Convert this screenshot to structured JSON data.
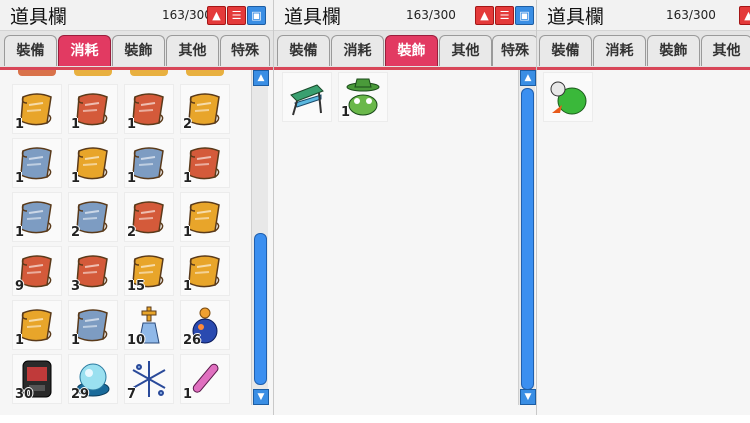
{
  "colors": {
    "scroll_gold": "#e8a52a",
    "scroll_red": "#d45a3a",
    "scroll_blue": "#7d9cc2",
    "active_tab": "#e23a62"
  },
  "panels": [
    {
      "title": "道具欄",
      "count": "163/300",
      "tabs": [
        "裝備",
        "消耗",
        "裝飾",
        "其他",
        "特殊"
      ],
      "active_tab": "消耗",
      "items": [
        {
          "icon": "gold-scroll-icon",
          "qty": "1"
        },
        {
          "icon": "red-scroll-icon",
          "qty": "1"
        },
        {
          "icon": "red-scroll-icon",
          "qty": "1"
        },
        {
          "icon": "gold-scroll-icon",
          "qty": "2"
        },
        {
          "icon": "blue-scroll-icon",
          "qty": "1"
        },
        {
          "icon": "gold-scroll-icon",
          "qty": "1"
        },
        {
          "icon": "blue-scroll-icon",
          "qty": "1"
        },
        {
          "icon": "red-scroll-icon",
          "qty": "1"
        },
        {
          "icon": "blue-scroll-icon",
          "qty": "1"
        },
        {
          "icon": "blue-scroll-icon",
          "qty": "2"
        },
        {
          "icon": "red-scroll-icon",
          "qty": "2"
        },
        {
          "icon": "gold-scroll-icon",
          "qty": "1"
        },
        {
          "icon": "red-scroll-icon",
          "qty": "9"
        },
        {
          "icon": "red-scroll-icon",
          "qty": "3"
        },
        {
          "icon": "gold-scroll-icon",
          "qty": "15"
        },
        {
          "icon": "gold-scroll-icon",
          "qty": "1"
        },
        {
          "icon": "gold-scroll-icon",
          "qty": "1"
        },
        {
          "icon": "blue-scroll-icon",
          "qty": "1"
        },
        {
          "icon": "cross-potion-icon",
          "qty": "10"
        },
        {
          "icon": "blue-potion-icon",
          "qty": "26"
        },
        {
          "icon": "device-icon",
          "qty": "30"
        },
        {
          "icon": "crystal-orb-icon",
          "qty": "29"
        },
        {
          "icon": "snowflake-icon",
          "qty": "7"
        },
        {
          "icon": "pink-vial-icon",
          "qty": "1"
        }
      ]
    },
    {
      "title": "道具欄",
      "count": "163/300",
      "tabs": [
        "裝備",
        "消耗",
        "裝飾",
        "其他",
        "特殊"
      ],
      "active_tab": "裝飾",
      "items": [
        {
          "icon": "beach-chair-icon",
          "qty": ""
        },
        {
          "icon": "frog-hat-icon",
          "qty": "1"
        }
      ]
    },
    {
      "title": "道具欄",
      "count": "163/300",
      "tabs": [
        "裝備",
        "消耗",
        "裝飾",
        "其他"
      ],
      "active_tab": "",
      "items": [
        {
          "icon": "green-bird-icon",
          "qty": ""
        }
      ]
    }
  ]
}
